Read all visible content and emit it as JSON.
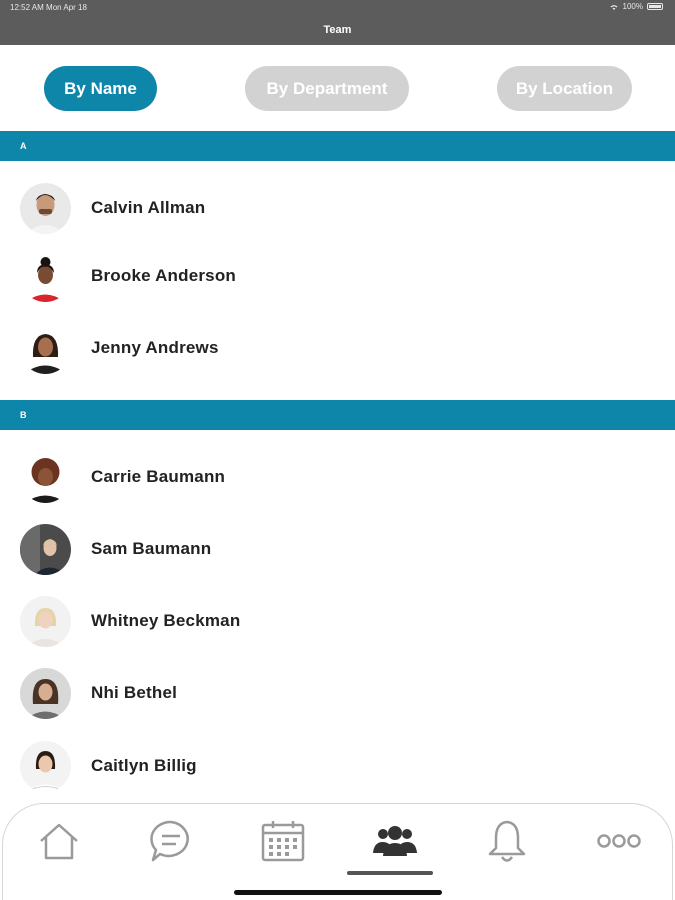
{
  "status": {
    "time": "12:52 AM   Mon Apr 18",
    "battery": "100%"
  },
  "nav": {
    "title": "Team"
  },
  "segments": {
    "by_name": "By Name",
    "by_department": "By Department",
    "by_location": "By Location",
    "active": "by_name"
  },
  "sections": [
    {
      "letter": "A",
      "people": [
        "Calvin Allman",
        "Brooke Anderson",
        "Jenny Andrews"
      ]
    },
    {
      "letter": "B",
      "people": [
        "Carrie Baumann",
        "Sam Baumann",
        "Whitney Beckman",
        "Nhi Bethel",
        "Caitlyn Billig"
      ]
    }
  ],
  "tabs": [
    "home-icon",
    "chat-icon",
    "calendar-icon",
    "team-icon",
    "bell-icon",
    "more-icon"
  ],
  "active_tab": "team-icon",
  "colors": {
    "accent": "#0e86aa",
    "inactive_segment": "#d2d2d2",
    "status_bar": "#5c5c5c",
    "icon_gray": "#9a9a9a"
  }
}
